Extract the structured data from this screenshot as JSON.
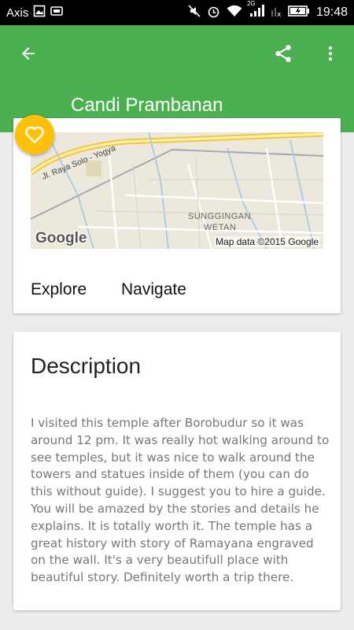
{
  "status_bar": {
    "carrier": "Axis",
    "network_badge": "2G",
    "time": "19:48",
    "icons": [
      "image-notification-icon",
      "screenshot-notification-icon",
      "mute-icon",
      "alarm-icon",
      "wifi-icon",
      "signal-icon",
      "no-sim-icon",
      "battery-icon"
    ]
  },
  "toolbar": {
    "title": "Candi Prambanan",
    "color": "#4caf50",
    "icons": [
      "back-arrow-icon",
      "share-icon",
      "more-vert-icon"
    ]
  },
  "map": {
    "road_label": "Jl. Raya Solo - Yogya",
    "area_label_1": "SUNGGINGAN",
    "area_label_2": "WETAN",
    "logo": "Google",
    "attribution": "Map data ©2015 Google"
  },
  "actions": {
    "explore": "Explore",
    "navigate": "Navigate"
  },
  "favorite": {
    "icon": "heart-outline-icon",
    "color": "#ffc107"
  },
  "description": {
    "heading": "Description",
    "body": "I visited this temple after Borobudur so it was around 12 pm. It was really hot walking around to see temples, but it was nice to walk around the towers and statues inside of them (you can do this without guide). I suggest you to hire a guide. You will be amazed by the stories and details he explains. It is totally worth it. The temple has a great history with story of Ramayana engraved on the wall. It's a very beautifull place with beautiful story. Definitely worth a trip there."
  }
}
